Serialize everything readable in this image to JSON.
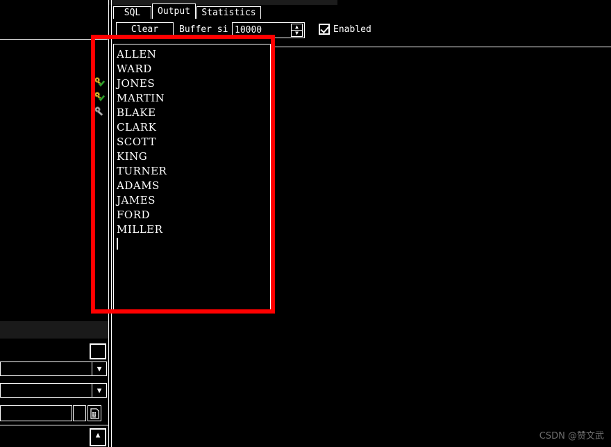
{
  "window": {
    "background_color": "#000000",
    "foreground_color": "#ffffff"
  },
  "tabs": [
    {
      "label": "SQL",
      "active": false
    },
    {
      "label": "Output",
      "active": true
    },
    {
      "label": "Statistics",
      "active": false
    }
  ],
  "toolbar": {
    "clear_label": "Clear",
    "buffer_label": "Buffer si",
    "buffer_value": "10000",
    "spinner_up_icon": "chevron-up-icon",
    "spinner_down_icon": "chevron-down-icon",
    "enabled_label": "Enabled",
    "enabled_checked": true
  },
  "sidebar": {
    "icons": [
      {
        "name": "key-check-gold-icon"
      },
      {
        "name": "key-check-gold-icon"
      },
      {
        "name": "key-gray-icon"
      }
    ]
  },
  "output": {
    "lines": [
      "ALLEN",
      "WARD",
      "JONES",
      "MARTIN",
      "BLAKE",
      "CLARK",
      "SCOTT",
      "KING",
      "TURNER",
      "ADAMS",
      "JAMES",
      "FORD",
      "MILLER"
    ],
    "caret_visible": true
  },
  "annotation": {
    "shape": "rectangle",
    "color": "#ff0000",
    "stroke_width": 6
  },
  "form_controls": {
    "square_button_icon": "blank-button-icon",
    "combo_one_value": "",
    "combo_two_value": "",
    "combo_arrow_icon": "chevron-down-icon",
    "text_field_value": "",
    "small_button_icon": "blank-button-icon",
    "doc_button_icon": "document-icon",
    "bottom_spin_icon": "chevron-up-icon"
  },
  "watermark": {
    "text": "CSDN @赞文武"
  }
}
